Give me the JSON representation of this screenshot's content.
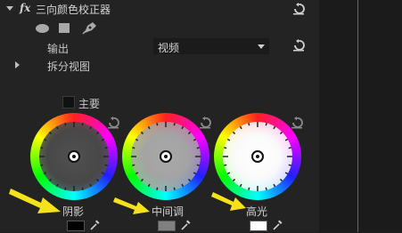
{
  "effect": {
    "fx_label": "fx",
    "title": "三向颜色校正器"
  },
  "output": {
    "label": "输出",
    "value": "视频"
  },
  "split_view": {
    "label": "拆分视图"
  },
  "master": {
    "label": "主要"
  },
  "wheels": [
    {
      "label": "阴影",
      "swatch_color": "#000000"
    },
    {
      "label": "中间调",
      "swatch_color": "#808080"
    },
    {
      "label": "高光",
      "swatch_color": "#ffffff"
    }
  ],
  "colors": {
    "accent_blue": "#2d6fd6",
    "annotation_arrow": "#f5e21a"
  },
  "icons": [
    "reset-icon",
    "ellipse-mask-icon",
    "rectangle-mask-icon",
    "pen-mask-icon",
    "eyedropper-icon",
    "collapse-arrow-icon",
    "expand-arrow-icon"
  ]
}
